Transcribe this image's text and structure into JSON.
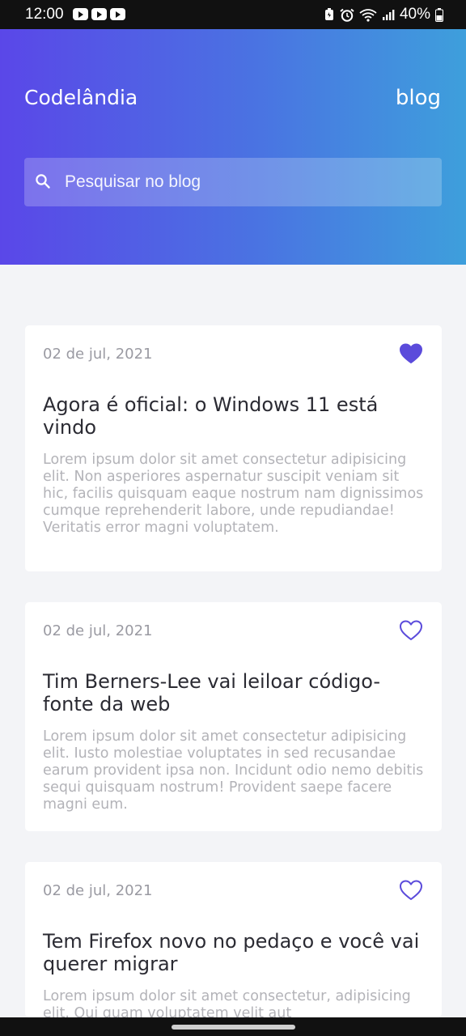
{
  "status_bar": {
    "time": "12:00",
    "battery": "40%"
  },
  "header": {
    "brand": "Codelândia",
    "link": "blog"
  },
  "search": {
    "placeholder": "Pesquisar no blog",
    "value": ""
  },
  "colors": {
    "accent": "#5b4bdb",
    "gradient_start": "#5a47e8",
    "gradient_end": "#3e9fdc",
    "background": "#f3f4f7"
  },
  "posts": [
    {
      "date": "02 de jul, 2021",
      "liked": true,
      "title": "Agora é oficial: o Windows 11 está vindo",
      "body": "Lorem ipsum dolor sit amet consectetur adipisicing elit. Non asperiores aspernatur suscipit veniam sit hic, facilis quisquam eaque nostrum nam dignissimos cumque reprehenderit labore, unde repudiandae! Veritatis error magni voluptatem."
    },
    {
      "date": "02 de jul, 2021",
      "liked": false,
      "title": "Tim Berners-Lee vai leiloar código-fonte da web",
      "body": "Lorem ipsum dolor sit amet consectetur adipisicing elit. Iusto molestiae voluptates in sed recusandae earum provident ipsa non. Incidunt odio nemo debitis sequi quisquam nostrum! Provident saepe facere magni eum."
    },
    {
      "date": "02 de jul, 2021",
      "liked": false,
      "title": "Tem Firefox novo no pedaço e você vai querer migrar",
      "body": "Lorem ipsum dolor sit amet consectetur, adipisicing elit. Qui quam voluptatem velit aut"
    }
  ]
}
